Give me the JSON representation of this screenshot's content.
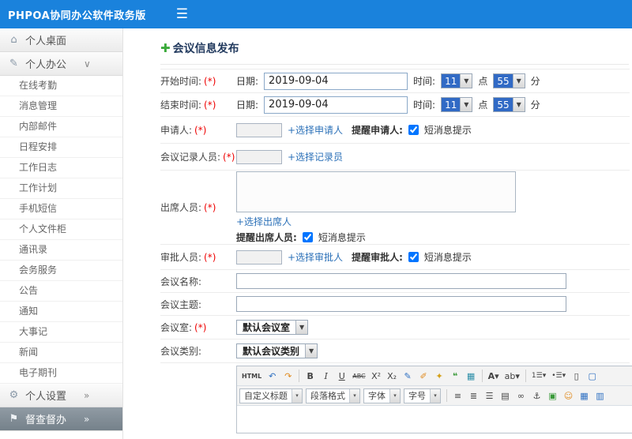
{
  "colors": {
    "topbar_blue": "#1a82dc",
    "link_blue": "#2c71b8",
    "required_red": "#ee0000",
    "plus_green": "#3aaa3a",
    "select_highlight": "#316ac5"
  },
  "glyphs": {
    "select_arrow": "▼",
    "small_arrow": "▾"
  },
  "topbar": {
    "title": "PHPOA协同办公软件政务版",
    "menu_icon": "☰"
  },
  "sidebar": {
    "desktop": {
      "icon": "⌂",
      "label": "个人桌面"
    },
    "office": {
      "icon": "✎",
      "label": "个人办公",
      "chevron": "∨"
    },
    "items": [
      "在线考勤",
      "消息管理",
      "内部邮件",
      "日程安排",
      "工作日志",
      "工作计划",
      "手机短信",
      "个人文件柜",
      "通讯录",
      "会务服务",
      "公告",
      "通知",
      "大事记",
      "新闻",
      "电子期刊"
    ],
    "settings": {
      "icon": "⚙",
      "label": "个人设置",
      "chevron": "»"
    },
    "supervision": {
      "icon": "⚑",
      "label": "督查督办",
      "chevron": "»"
    }
  },
  "main": {
    "plus_icon": "✚",
    "title": "会议信息发布",
    "required": "(*)",
    "rows": {
      "start_time": {
        "label": "开始时间:",
        "date_label": "日期:",
        "date": "2019-09-04",
        "time_label": "时间:",
        "hour": "11",
        "hour_unit": "点",
        "minute": "55",
        "minute_unit": "分"
      },
      "end_time": {
        "label": "结束时间:",
        "date_label": "日期:",
        "date": "2019-09-04",
        "time_label": "时间:",
        "hour": "11",
        "hour_unit": "点",
        "minute": "55",
        "minute_unit": "分"
      },
      "applicant": {
        "label": "申请人:",
        "link": "+选择申请人",
        "remind": "提醒申请人:",
        "sms": "短消息提示"
      },
      "recorder": {
        "label": "会议记录人员:",
        "link": "+选择记录员"
      },
      "attendees": {
        "label": "出席人员:",
        "link": "+选择出席人",
        "remind": "提醒出席人员:",
        "sms": "短消息提示"
      },
      "approver": {
        "label": "审批人员:",
        "link": "+选择审批人",
        "remind": "提醒审批人:",
        "sms": "短消息提示"
      },
      "meeting_name": {
        "label": "会议名称:"
      },
      "meeting_subject": {
        "label": "会议主题:"
      },
      "meeting_room": {
        "label": "会议室:",
        "value": "默认会议室"
      },
      "meeting_type": {
        "label": "会议类别:",
        "value": "默认会议类别"
      }
    },
    "editor": {
      "toolbar1": [
        "HTML",
        "↶",
        "↷",
        "B",
        "I",
        "U",
        "ABC",
        "X²",
        "X₂",
        "✎",
        "✐",
        "✦",
        "❝",
        "▦",
        "A▾",
        "ab▾",
        "1☰▾",
        "•☰▾",
        "▯",
        "▢"
      ],
      "selects": [
        "自定义标题",
        "段落格式",
        "字体",
        "字号"
      ],
      "toolbar2": [
        "≡",
        "≣",
        "☰",
        "▤",
        "∞",
        "⚓",
        "▣",
        "☺",
        "▦",
        "▥"
      ]
    }
  }
}
